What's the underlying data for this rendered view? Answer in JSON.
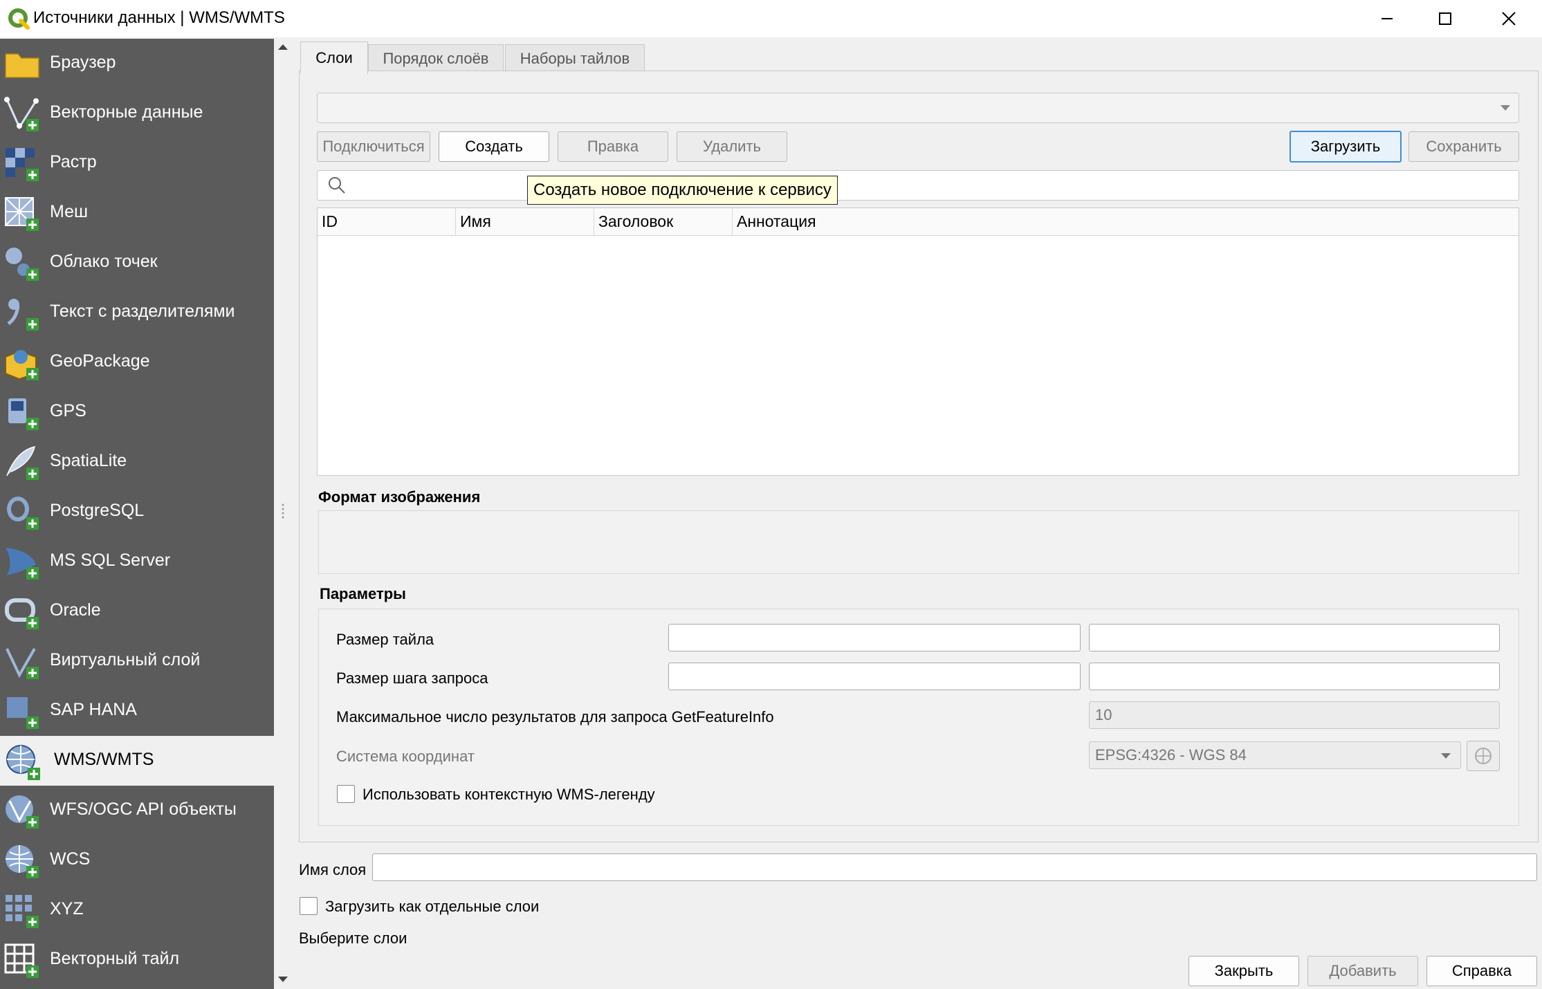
{
  "window": {
    "title": "Источники данных | WMS/WMTS"
  },
  "sidebar": {
    "items": [
      {
        "label": "Браузер",
        "icon": "folder-icon"
      },
      {
        "label": "Векторные данные",
        "icon": "vector-add-icon"
      },
      {
        "label": "Растр",
        "icon": "raster-add-icon"
      },
      {
        "label": "Меш",
        "icon": "mesh-add-icon"
      },
      {
        "label": "Облако точек",
        "icon": "point-cloud-add-icon"
      },
      {
        "label": "Текст с разделителями",
        "icon": "delimited-text-add-icon"
      },
      {
        "label": "GeoPackage",
        "icon": "geopackage-add-icon"
      },
      {
        "label": "GPS",
        "icon": "gps-add-icon"
      },
      {
        "label": "SpatiaLite",
        "icon": "spatialite-add-icon"
      },
      {
        "label": "PostgreSQL",
        "icon": "postgresql-add-icon"
      },
      {
        "label": "MS SQL Server",
        "icon": "mssql-add-icon"
      },
      {
        "label": "Oracle",
        "icon": "oracle-add-icon"
      },
      {
        "label": "Виртуальный слой",
        "icon": "virtual-layer-add-icon"
      },
      {
        "label": "SAP HANA",
        "icon": "sap-hana-add-icon"
      },
      {
        "label": "WMS/WMTS",
        "icon": "wms-add-icon"
      },
      {
        "label": "WFS/OGC API объекты",
        "icon": "wfs-add-icon"
      },
      {
        "label": "WCS",
        "icon": "wcs-add-icon"
      },
      {
        "label": "XYZ",
        "icon": "xyz-add-icon"
      },
      {
        "label": "Векторный тайл",
        "icon": "vector-tile-add-icon"
      }
    ],
    "active_index": 14
  },
  "tabs": [
    "Слои",
    "Порядок слоёв",
    "Наборы тайлов"
  ],
  "buttons": {
    "connect": "Подключиться",
    "create": "Создать",
    "edit": "Правка",
    "delete": "Удалить",
    "load": "Загрузить",
    "save": "Сохранить"
  },
  "tooltip": "Создать новое подключение к сервису",
  "table": {
    "columns": [
      "ID",
      "Имя",
      "Заголовок",
      "Аннотация"
    ]
  },
  "image_format": {
    "heading": "Формат изображения"
  },
  "params": {
    "heading": "Параметры",
    "tile_size": "Размер тайла",
    "request_step": "Размер шага запроса",
    "max_results": "Максимальное число результатов для запроса GetFeatureInfo",
    "max_results_value": "10",
    "crs_label": "Система координат",
    "crs_value": "EPSG:4326 - WGS 84",
    "contextual_legend": "Использовать контекстную WMS-легенду"
  },
  "layer_name_label": "Имя слоя",
  "load_separate": "Загрузить как отдельные слои",
  "status": "Выберите слои",
  "footer": {
    "close": "Закрыть",
    "add": "Добавить",
    "help": "Справка"
  }
}
